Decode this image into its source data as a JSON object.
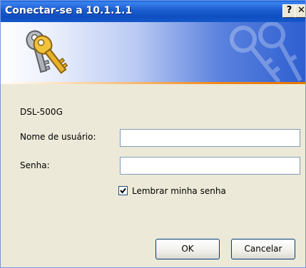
{
  "window": {
    "title": "Conectar-se a 10.1.1.1",
    "help_label": "?",
    "close_label": "✕"
  },
  "dialog": {
    "device_name": "DSL-500G",
    "username_label": "Nome de usuário:",
    "username_value": "",
    "password_label": "Senha:",
    "password_value": "",
    "remember_label": "Lembrar minha senha",
    "remember_checked": true,
    "ok_label": "OK",
    "cancel_label": "Cancelar"
  },
  "colors": {
    "titlebar": "#0f4fc2",
    "accent_line": "#f08a1c",
    "dialog_bg": "#ece9d8"
  },
  "icons": [
    "keys-icon",
    "background-keys-icon",
    "checkmark-icon"
  ]
}
